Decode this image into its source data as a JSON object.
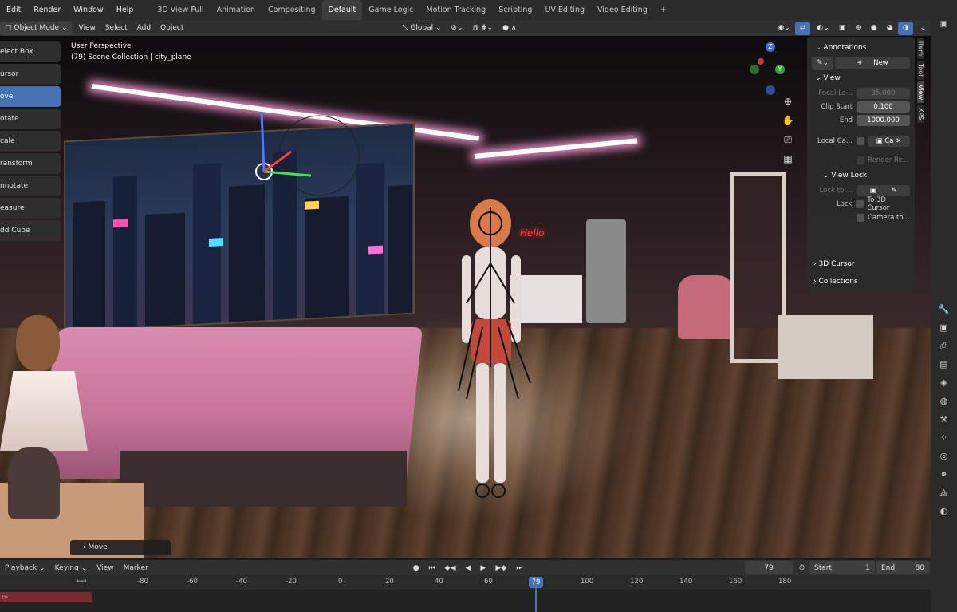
{
  "topmenu": [
    "Edit",
    "Render",
    "Window",
    "Help"
  ],
  "workspaces": [
    {
      "label": "3D View Full",
      "active": false
    },
    {
      "label": "Animation",
      "active": false
    },
    {
      "label": "Compositing",
      "active": false
    },
    {
      "label": "Default",
      "active": true
    },
    {
      "label": "Game Logic",
      "active": false
    },
    {
      "label": "Motion Tracking",
      "active": false
    },
    {
      "label": "Scripting",
      "active": false
    },
    {
      "label": "UV Editing",
      "active": false
    },
    {
      "label": "Video Editing",
      "active": false
    }
  ],
  "header": {
    "mode": "Object Mode",
    "menus": [
      "View",
      "Select",
      "Add",
      "Object"
    ],
    "orientation": "Global"
  },
  "viewport": {
    "perspective": "User Perspective",
    "collection": "(79) Scene Collection | city_plane",
    "neon_sign": "Hello",
    "last_op": "Move"
  },
  "tools": [
    {
      "label": "elect Box",
      "active": false
    },
    {
      "label": "ursor",
      "active": false
    },
    {
      "label": "ove",
      "active": true
    },
    {
      "label": "otate",
      "active": false
    },
    {
      "label": "cale",
      "active": false
    },
    {
      "label": "ransform",
      "active": false
    },
    {
      "label": "nnotate",
      "active": false
    },
    {
      "label": "easure",
      "active": false
    },
    {
      "label": "dd Cube",
      "active": false
    }
  ],
  "gizmo": {
    "z": "Z",
    "y": "Y"
  },
  "npanel": {
    "annotations_title": "Annotations",
    "new_label": "New",
    "view_title": "View",
    "focal_label": "Focal Le...",
    "focal_value": "35.000",
    "clip_start_label": "Clip Start",
    "clip_start_value": "0.100",
    "end_label": "End",
    "end_value": "1000.000",
    "local_camera_label": "Local Ca...",
    "local_camera_value": "Ca",
    "render_region_label": "Render Re...",
    "view_lock_title": "View Lock",
    "lock_to_label": "Lock to ...",
    "lock_label": "Lock",
    "to_3d_cursor": "To 3D Cursor",
    "camera_to": "Camera to...",
    "cursor_title": "3D Cursor",
    "collections_title": "Collections"
  },
  "sidetabs": [
    {
      "label": "Item",
      "active": false
    },
    {
      "label": "Tool",
      "active": false
    },
    {
      "label": "View",
      "active": true
    },
    {
      "label": "XPS",
      "active": false
    }
  ],
  "timeline": {
    "menus": [
      "Playback",
      "Keying",
      "View",
      "Marker"
    ],
    "current_frame": "79",
    "start_label": "Start",
    "start_value": "1",
    "end_label": "End",
    "end_value": "80",
    "ticks": [
      "-80",
      "-60",
      "-40",
      "-20",
      "0",
      "20",
      "40",
      "60",
      "100",
      "120",
      "140",
      "160",
      "180"
    ],
    "playhead": "79",
    "track_label": "ry"
  },
  "colors": {
    "accent": "#4772b3",
    "panel": "#2a2a2a",
    "timeline_track": "#7a2a2e"
  }
}
